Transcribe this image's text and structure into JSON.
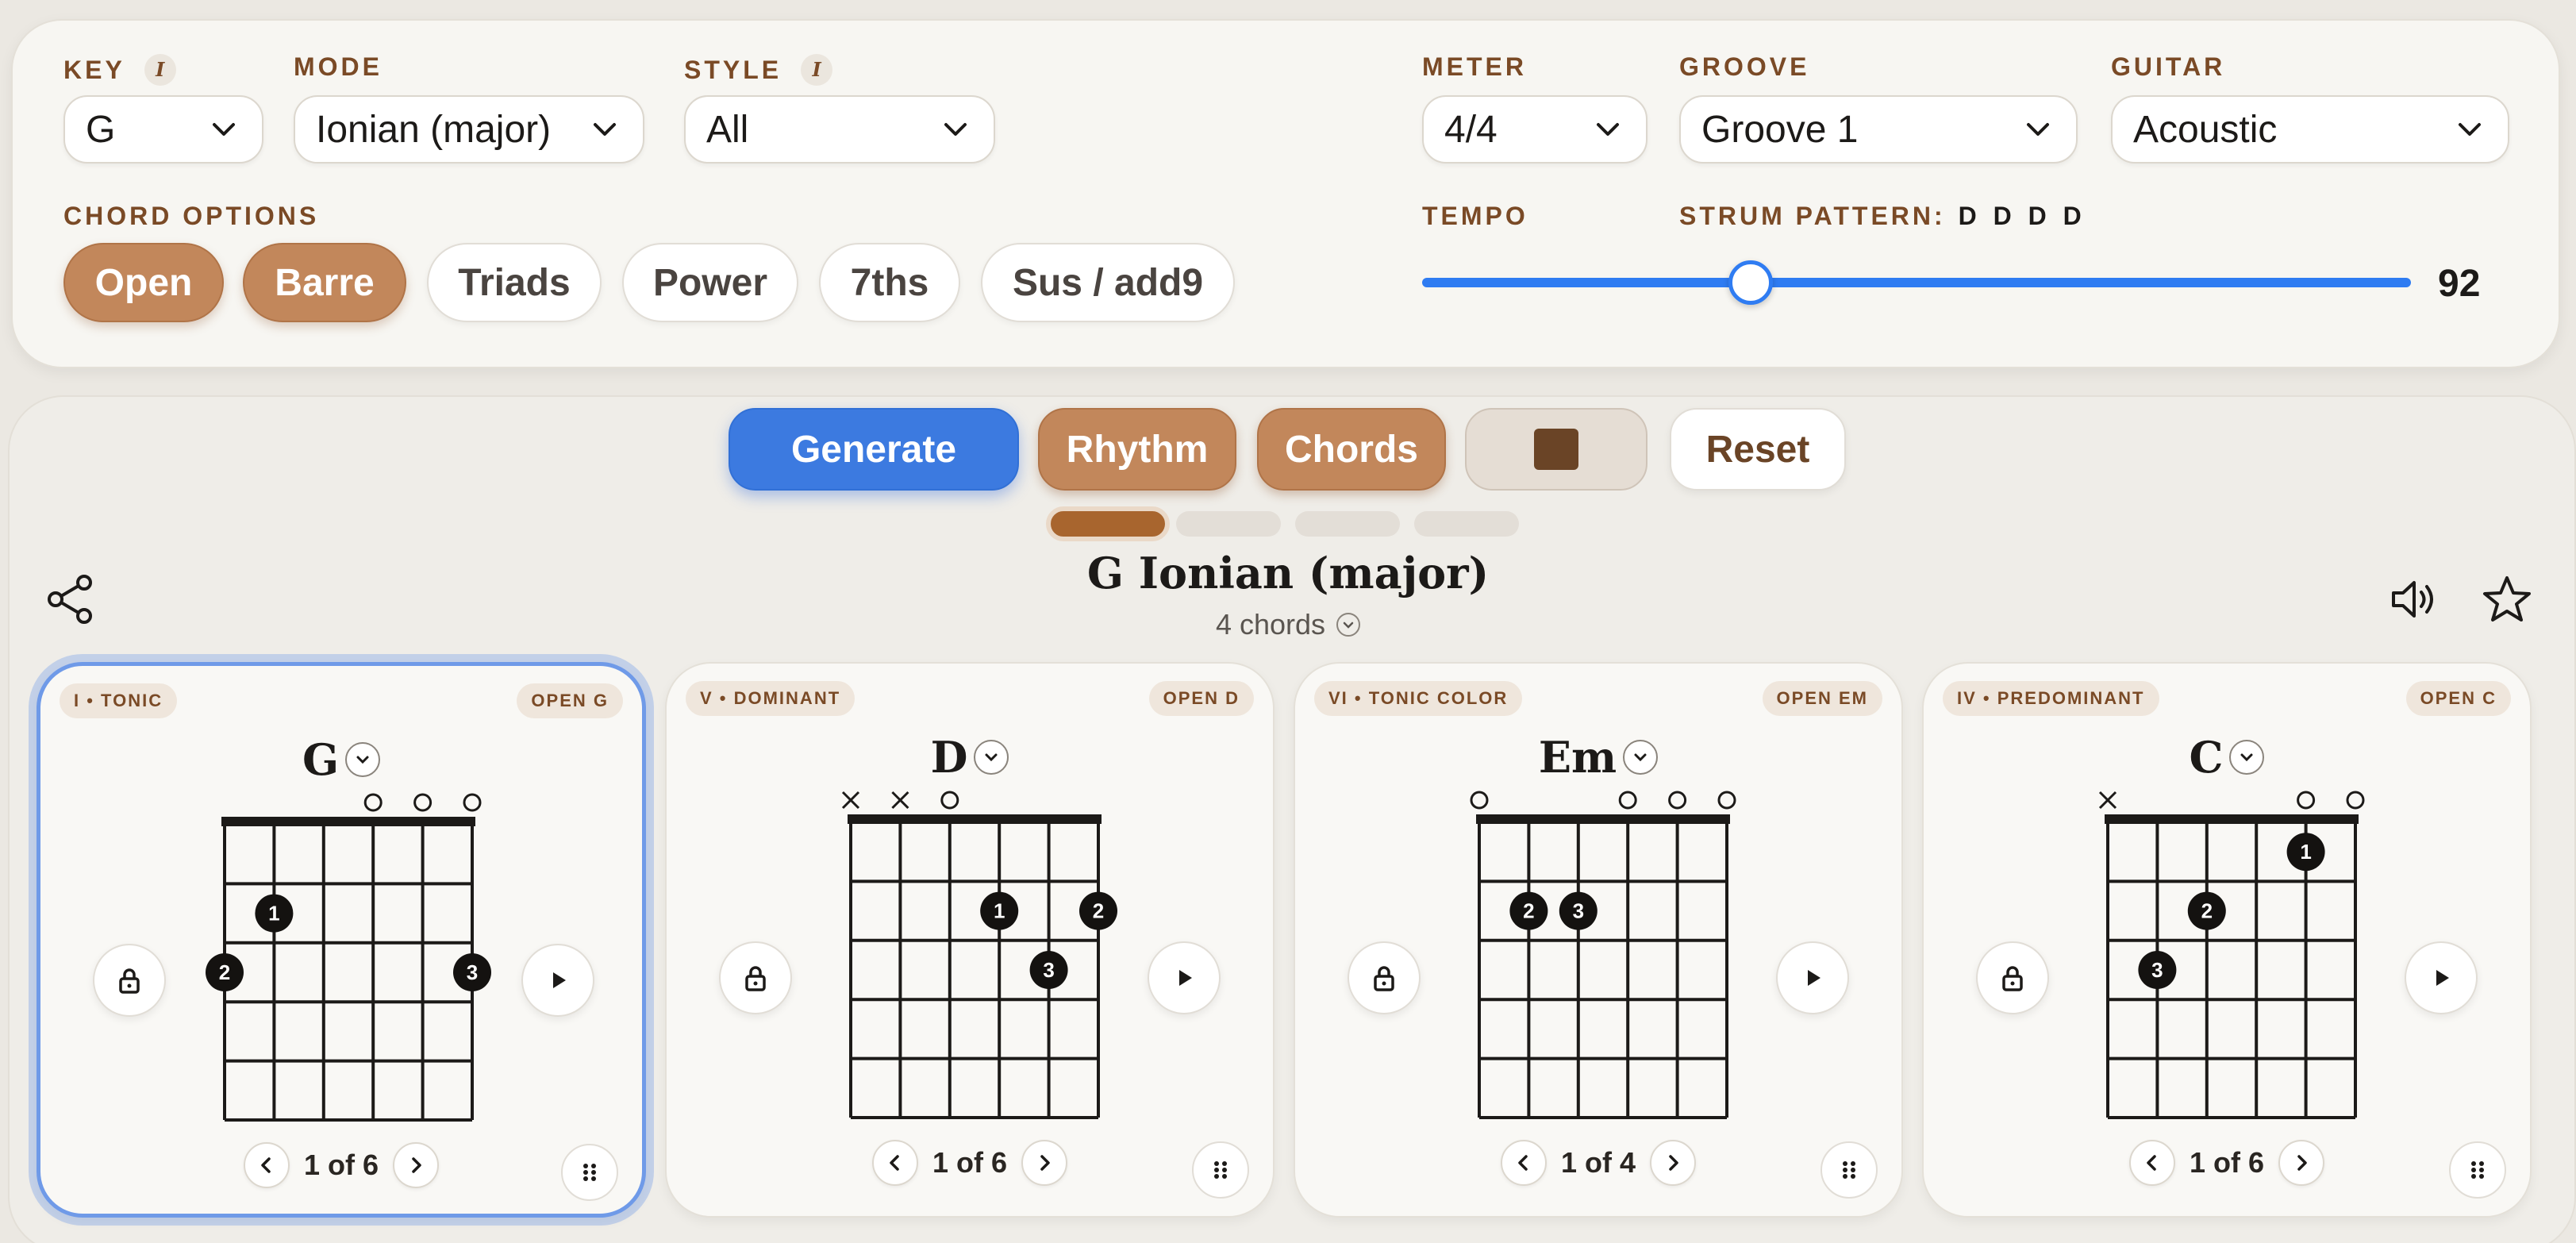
{
  "settings": {
    "key": {
      "label": "KEY",
      "value": "G"
    },
    "mode": {
      "label": "MODE",
      "value": "Ionian (major)"
    },
    "style": {
      "label": "STYLE",
      "value": "All"
    },
    "meter": {
      "label": "METER",
      "value": "4/4"
    },
    "groove": {
      "label": "GROOVE",
      "value": "Groove 1"
    },
    "guitar": {
      "label": "GUITAR",
      "value": "Acoustic"
    },
    "info_icon": "i",
    "chord_options": {
      "label": "CHORD OPTIONS",
      "chips": [
        {
          "label": "Open",
          "active": true
        },
        {
          "label": "Barre",
          "active": true
        },
        {
          "label": "Triads",
          "active": false
        },
        {
          "label": "Power",
          "active": false
        },
        {
          "label": "7ths",
          "active": false
        },
        {
          "label": "Sus / add9",
          "active": false
        }
      ]
    },
    "tempo": {
      "label": "TEMPO",
      "value": "92",
      "slider_fraction": 0.33
    },
    "strum": {
      "label": "STRUM PATTERN:",
      "value": "D D D D"
    }
  },
  "actions": {
    "generate": "Generate",
    "rhythm": "Rhythm",
    "chords": "Chords",
    "stop_icon": "stop-icon",
    "reset": "Reset"
  },
  "progress": {
    "steps": 4,
    "active": 0
  },
  "progression": {
    "title": "G Ionian (major)",
    "count": "4 chords"
  },
  "icons": {
    "share": "share-icon",
    "sound": "speaker-icon",
    "favorite": "star-icon"
  },
  "colors": {
    "accent_blue": "#3c7ae0",
    "accent_brown": "#c2875b",
    "label_brown": "#7a4a26",
    "background": "#ebe8e2"
  },
  "cards": [
    {
      "function": "I • TONIC",
      "voicing": "OPEN G",
      "name": "G",
      "pager": "1 of 6",
      "selected": true,
      "strings": [
        "",
        "",
        "",
        "o",
        "o",
        "o"
      ],
      "dots": [
        {
          "s": 2,
          "f": 2,
          "n": "1"
        },
        {
          "s": 1,
          "f": 3,
          "n": "2"
        },
        {
          "s": 6,
          "f": 3,
          "n": "3"
        }
      ]
    },
    {
      "function": "V • DOMINANT",
      "voicing": "OPEN D",
      "name": "D",
      "pager": "1 of 6",
      "selected": false,
      "strings": [
        "x",
        "x",
        "o",
        "",
        "",
        ""
      ],
      "dots": [
        {
          "s": 4,
          "f": 2,
          "n": "1"
        },
        {
          "s": 6,
          "f": 2,
          "n": "2"
        },
        {
          "s": 5,
          "f": 3,
          "n": "3"
        }
      ]
    },
    {
      "function": "VI • TONIC COLOR",
      "voicing": "OPEN EM",
      "name": "Em",
      "pager": "1 of 4",
      "selected": false,
      "strings": [
        "o",
        "",
        "",
        "o",
        "o",
        "o"
      ],
      "dots": [
        {
          "s": 2,
          "f": 2,
          "n": "2"
        },
        {
          "s": 3,
          "f": 2,
          "n": "3"
        }
      ]
    },
    {
      "function": "IV • PREDOMINANT",
      "voicing": "OPEN C",
      "name": "C",
      "pager": "1 of 6",
      "selected": false,
      "strings": [
        "x",
        "",
        "",
        "",
        "o",
        "o"
      ],
      "dots": [
        {
          "s": 5,
          "f": 1,
          "n": "1"
        },
        {
          "s": 3,
          "f": 2,
          "n": "2"
        },
        {
          "s": 2,
          "f": 3,
          "n": "3"
        }
      ]
    }
  ]
}
